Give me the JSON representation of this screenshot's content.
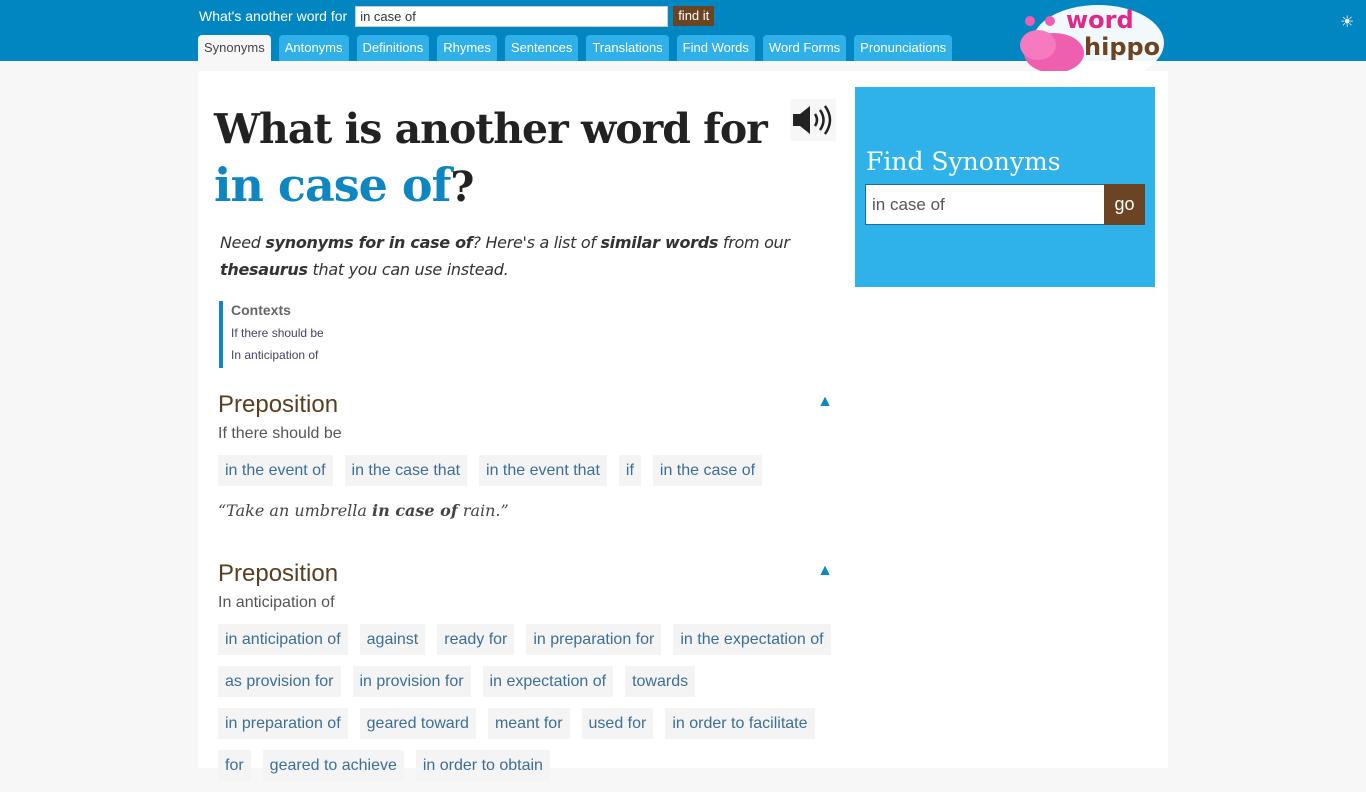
{
  "header": {
    "search_label": "What's another word for",
    "search_value": "in case of",
    "find_button": "find it",
    "tabs": [
      {
        "label": "Synonyms",
        "active": true
      },
      {
        "label": "Antonyms"
      },
      {
        "label": "Definitions"
      },
      {
        "label": "Rhymes"
      },
      {
        "label": "Sentences"
      },
      {
        "label": "Translations"
      },
      {
        "label": "Find Words"
      },
      {
        "label": "Word Forms"
      },
      {
        "label": "Pronunciations"
      }
    ],
    "logo_top": "word",
    "logo_bottom": "hippo",
    "theme_icon": "☀"
  },
  "page": {
    "title_prefix": "What is another word for ",
    "title_word": "in case of",
    "title_suffix": "?",
    "intro": {
      "p1": "Need ",
      "b1": "synonyms for in case of",
      "p2": "? Here's a list of ",
      "b2": "similar words",
      "p3": " from our ",
      "b3": "thesaurus",
      "p4": " that you can use instead."
    },
    "contexts": {
      "title": "Contexts",
      "items": [
        "If there should be",
        "In anticipation of"
      ]
    },
    "sections": [
      {
        "pos": "Preposition",
        "sense": "If there should be",
        "words": [
          "in the event of",
          "in the case that",
          "in the event that",
          "if",
          "in the case of"
        ],
        "example_pre": "“Take an umbrella ",
        "example_bold": "in case of",
        "example_post": " rain.”"
      },
      {
        "pos": "Preposition",
        "sense": "In anticipation of",
        "words": [
          "in anticipation of",
          "against",
          "ready for",
          "in preparation for",
          "in the expectation of",
          "as provision for",
          "in provision for",
          "in expectation of",
          "towards",
          "in preparation of",
          "geared toward",
          "meant for",
          "used for",
          "in order to facilitate",
          "for",
          "geared to achieve",
          "in order to obtain"
        ]
      }
    ],
    "collapse_icon": "▲"
  },
  "sidebar": {
    "title": "Find Synonyms",
    "input_value": "in case of",
    "go_label": "go"
  },
  "colors": {
    "header_bg": "#0286c2",
    "tab_bg": "#30b0e8",
    "accent": "#0e86c2",
    "brown": "#6b4423",
    "sidebox_bg": "#2fb1e9",
    "chip_text": "#3d6e96"
  }
}
